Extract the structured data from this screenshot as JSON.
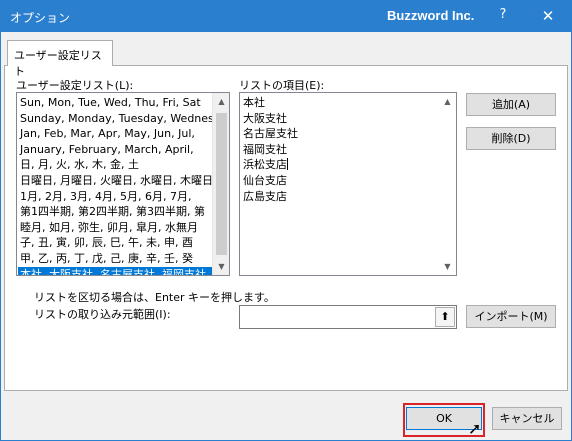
{
  "window": {
    "title": "オプション",
    "brand": "Buzzword Inc.",
    "help_glyph": "?",
    "close_glyph": "✕"
  },
  "tab": {
    "label": "ユーザー設定リスト"
  },
  "left_list": {
    "label": "ユーザー設定リスト(L):",
    "items": [
      "Sun, Mon, Tue, Wed, Thu, Fri, Sat",
      "Sunday, Monday, Tuesday, Wednesday",
      "Jan, Feb, Mar, Apr, May, Jun, Jul,",
      "January, February, March, April,",
      "日, 月, 火, 水, 木, 金, 土",
      "日曜日, 月曜日, 火曜日, 水曜日, 木曜日",
      "1月, 2月, 3月, 4月, 5月, 6月, 7月,",
      "第1四半期, 第2四半期, 第3四半期, 第",
      "睦月, 如月, 弥生, 卯月, 皐月, 水無月",
      "子, 丑, 寅, 卯, 辰, 巳, 午, 未, 申, 酉",
      "甲, 乙, 丙, 丁, 戊, 己, 庚, 辛, 壬, 癸",
      "本社, 大阪支社, 名古屋支社, 福岡支社"
    ],
    "selected_index": 11
  },
  "right_list": {
    "label": "リストの項目(E):",
    "lines": [
      "本社",
      "大阪支社",
      "名古屋支社",
      "福岡支社",
      "浜松支店",
      "仙台支店",
      "広島支店"
    ]
  },
  "buttons": {
    "add": "追加(A)",
    "delete": "削除(D)",
    "import": "インポート(M)",
    "ok": "OK",
    "cancel": "キャンセル"
  },
  "hint_text": "リストを区切る場合は、Enter キーを押します。",
  "import_range": {
    "label": "リストの取り込み元範囲(I):",
    "value": ""
  },
  "colors": {
    "titlebar": "#2b7fcf",
    "selection": "#0078d7",
    "ok_highlight": "#d9252a"
  }
}
